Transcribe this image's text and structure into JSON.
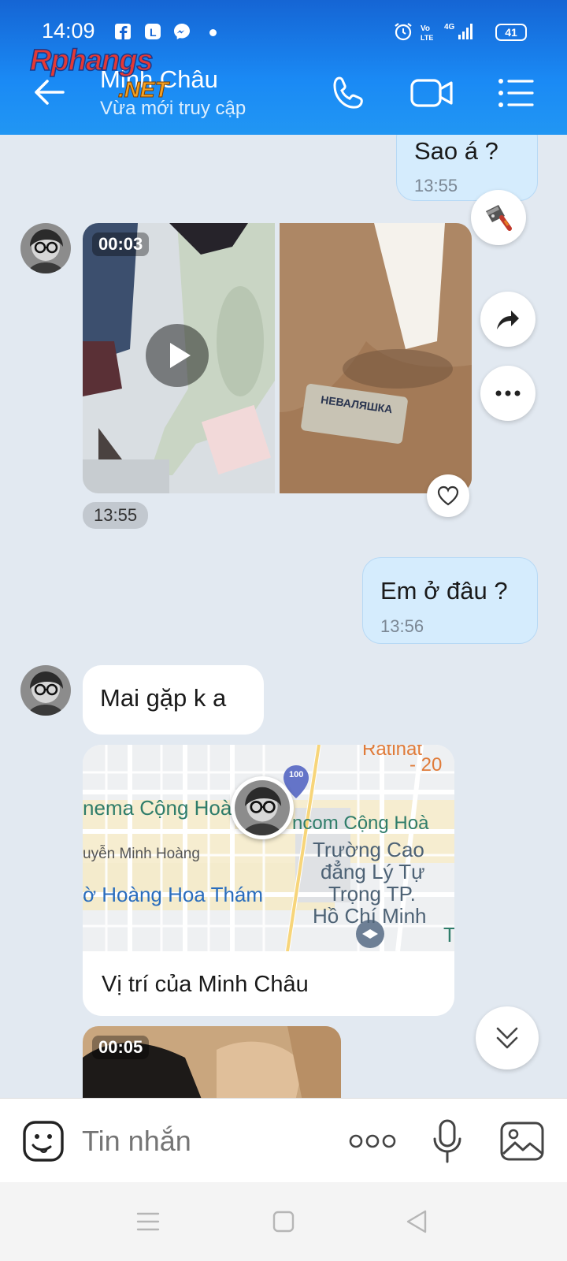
{
  "status_bar": {
    "time": "14:09",
    "battery": "41"
  },
  "header": {
    "title": "Minh Châu",
    "subtitle": "Vừa mới truy cập",
    "watermark_text": "Rphangs",
    "watermark_sub": ".NET"
  },
  "messages": {
    "m1": {
      "text": "Sao á ?",
      "time": "13:55"
    },
    "media1": {
      "duration": "00:03",
      "time": "13:55",
      "photo_label": "НЕВАЛЯШКА"
    },
    "m2": {
      "text": "Em ở đâu ?",
      "time": "13:56"
    },
    "m3": {
      "text": "Mai gặp k a"
    },
    "location": {
      "caption": "Vị trí của Minh Châu",
      "labels": [
        "nema Cộng Hoà",
        "ncom Cộng Hoà",
        "uyễn Minh Hoàng",
        "ờ Hoàng Hoa Thám",
        "Trường Cao",
        "đẳng Lý Tự",
        "Trọng TP.",
        "Hồ Chí Minh",
        "100",
        "T",
        "Ratinat",
        "- 20"
      ]
    },
    "media2": {
      "duration": "00:05"
    }
  },
  "input": {
    "placeholder": "Tin nhắn"
  },
  "colors": {
    "header": "#1a8af5",
    "chat_bg": "#e2e9f1",
    "outgoing_bubble": "#d5ecfd"
  }
}
